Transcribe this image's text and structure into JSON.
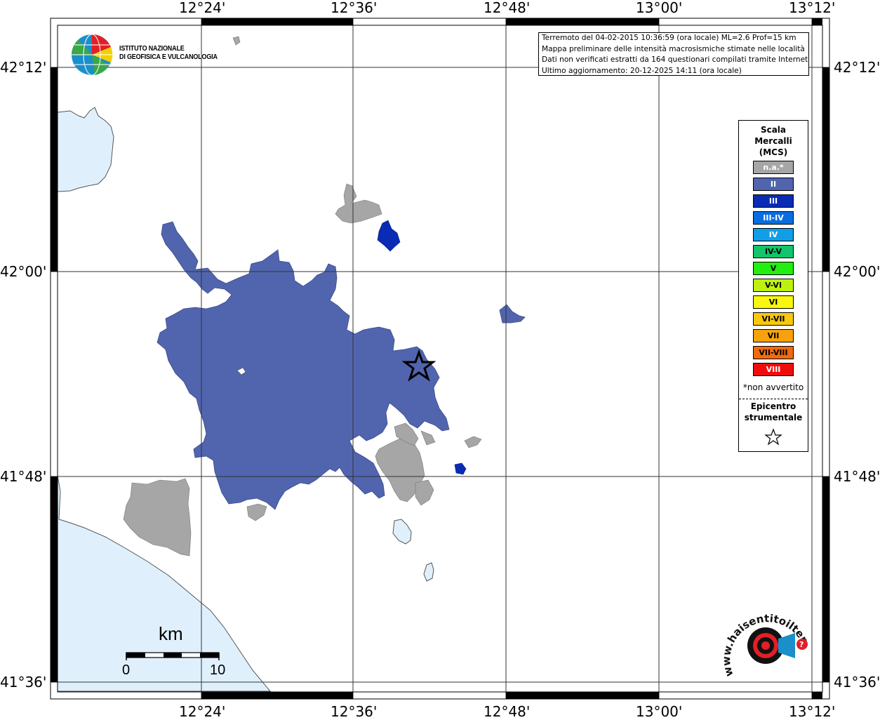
{
  "map": {
    "top_lon_labels": [
      "12°24'",
      "12°36'",
      "12°48'",
      "13°00'",
      "13°12'"
    ],
    "bottom_lon_labels": [
      "12°24'",
      "12°36'",
      "12°48'",
      "13°00'",
      "13°12'"
    ],
    "left_lat_labels": [
      "42°12'",
      "42°00'",
      "41°48'",
      "41°36'"
    ],
    "right_lat_labels": [
      "42°12'",
      "42°00'",
      "41°48'",
      "41°36'"
    ],
    "colors": {
      "sea": "#dff0fc",
      "intensity_II": "#5165ae",
      "intensity_III": "#0a2bb4",
      "na": "#a6a6a6"
    }
  },
  "info": {
    "line1": "Terremoto del 04-02-2015 10:36:59 (ora locale) ML=2.6 Prof=15 km",
    "line2": "Mappa preliminare delle intensità macrosismiche stimate nelle località",
    "line3": "Dati non verificati estratti da 164 questionari compilati tramite Internet.",
    "line4": "Ultimo aggiornamento: 20-12-2025 14:11 (ora locale)"
  },
  "logo": {
    "line1": "ISTITUTO NAZIONALE",
    "line2": "DI GEOFISICA E VULCANOLOGIA"
  },
  "legend": {
    "title1": "Scala",
    "title2": "Mercalli",
    "title3": "(MCS)",
    "items": [
      {
        "label": "n.a.*",
        "color": "#a6a6a6",
        "text_color": "#ffffff"
      },
      {
        "label": "II",
        "color": "#5165ae",
        "text_color": "#ffffff"
      },
      {
        "label": "III",
        "color": "#0a2bb4",
        "text_color": "#ffffff"
      },
      {
        "label": "III-IV",
        "color": "#0a6ee0",
        "text_color": "#ffffff"
      },
      {
        "label": "IV",
        "color": "#109ee8",
        "text_color": "#ffffff"
      },
      {
        "label": "IV-V",
        "color": "#12c46b",
        "text_color": "#000000"
      },
      {
        "label": "V",
        "color": "#22ee10",
        "text_color": "#000000"
      },
      {
        "label": "V-VI",
        "color": "#bdf20f",
        "text_color": "#000000"
      },
      {
        "label": "VI",
        "color": "#f8f70d",
        "text_color": "#000000"
      },
      {
        "label": "VI-VII",
        "color": "#f7c80c",
        "text_color": "#000000"
      },
      {
        "label": "VII",
        "color": "#f7a20c",
        "text_color": "#000000"
      },
      {
        "label": "VII-VIII",
        "color": "#f26a0c",
        "text_color": "#000000"
      },
      {
        "label": "VIII",
        "color": "#ee0c0c",
        "text_color": "#ffffff"
      }
    ],
    "note": "*non avvertito",
    "epicenter1": "Epicentro",
    "epicenter2": "strumentale"
  },
  "scale": {
    "unit": "km",
    "start": "0",
    "end": "10"
  },
  "watermark": {
    "text": "www.haisentitoilterremoto.it"
  }
}
